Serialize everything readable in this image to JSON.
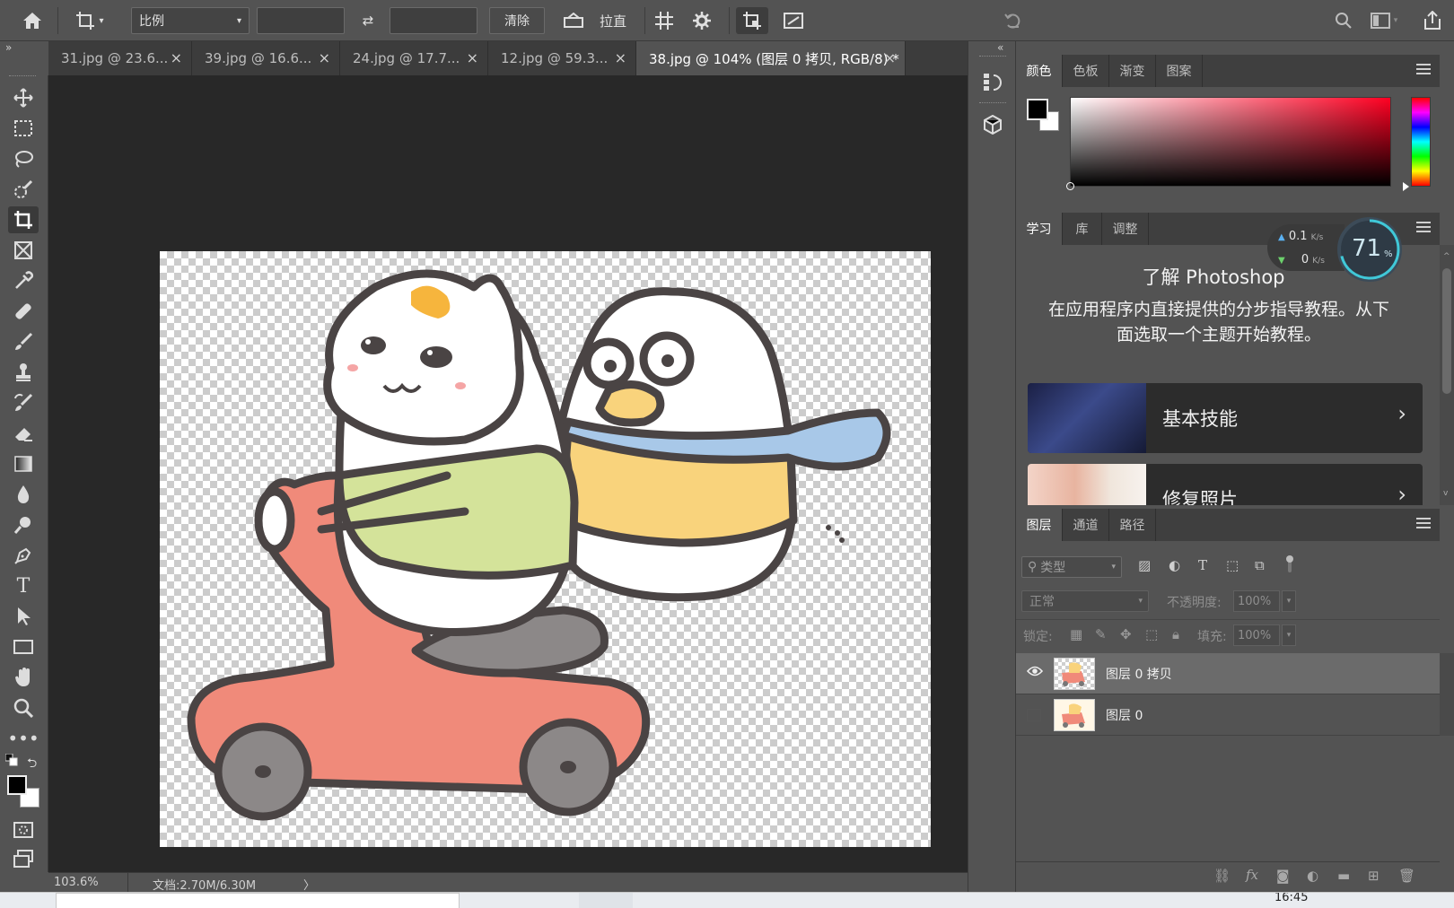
{
  "options_bar": {
    "ratio_select": "比例",
    "clear_label": "清除",
    "straighten_label": "拉直"
  },
  "tabs": [
    {
      "label": "31.jpg @ 23.6...",
      "active": false
    },
    {
      "label": "39.jpg @ 16.6...",
      "active": false
    },
    {
      "label": "24.jpg @ 17.7...",
      "active": false
    },
    {
      "label": "12.jpg @ 59.3...",
      "active": false
    },
    {
      "label": "38.jpg @ 104% (图层 0 拷贝, RGB/8) *",
      "active": true
    }
  ],
  "tab_close": "×",
  "status": {
    "zoom": "103.6%",
    "doc": "文档:2.70M/6.30M",
    "arrow": "〉"
  },
  "color_panel": {
    "tabs": [
      "颜色",
      "色板",
      "渐变",
      "图案"
    ]
  },
  "learn_panel": {
    "tabs": [
      "学习",
      "库",
      "调整"
    ],
    "heading": "了解 Photoshop",
    "description": "在应用程序内直接提供的分步指导教程。从下面选取一个主题开始教程。",
    "cards": [
      {
        "label": "基本技能"
      },
      {
        "label": "修复照片"
      }
    ]
  },
  "net_widget": {
    "up": "0.1",
    "up_unit": "K/s",
    "down": "0",
    "down_unit": "K/s",
    "percent": "71",
    "percent_unit": "%"
  },
  "layers_panel": {
    "tabs": [
      "图层",
      "通道",
      "路径"
    ],
    "filter_placeholder": "类型",
    "blend_mode": "正常",
    "opacity_label": "不透明度:",
    "opacity_value": "100%",
    "lock_label": "锁定:",
    "fill_label": "填充:",
    "fill_value": "100%",
    "layers": [
      {
        "name": "图层 0 拷贝",
        "visible": true,
        "selected": true
      },
      {
        "name": "图层 0",
        "visible": false,
        "selected": false
      }
    ]
  },
  "taskbar": {
    "time": "16:45"
  },
  "colors": {
    "foreground": "#000000",
    "background": "#ffffff",
    "scooter": "#f08a7a",
    "shirt_green": "#d4e39a",
    "shirt_yellow": "#f9d37c",
    "bowl_blue": "#a8c8e8"
  }
}
